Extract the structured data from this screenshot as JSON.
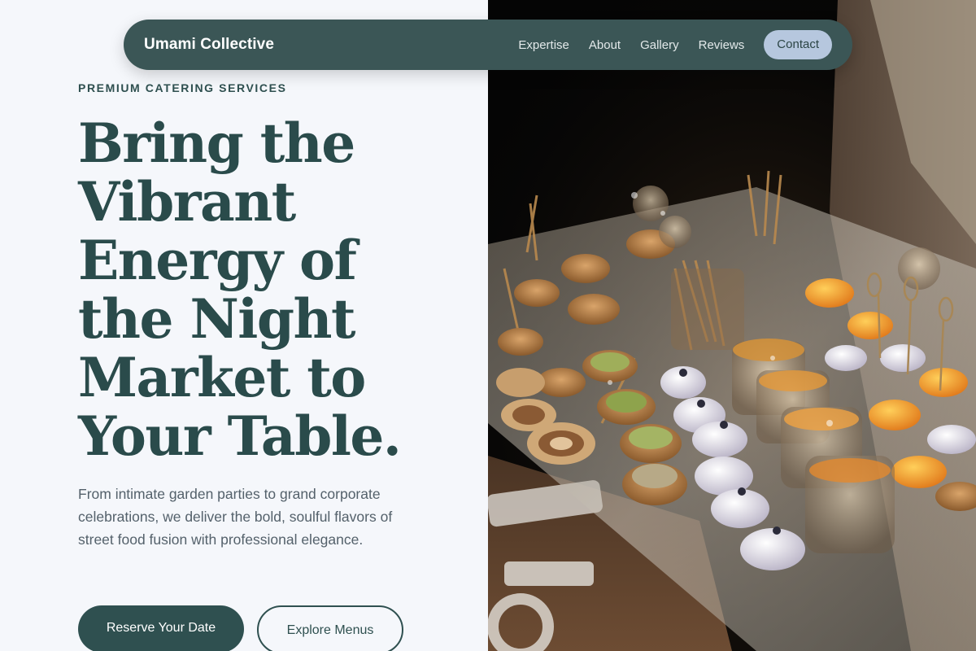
{
  "nav": {
    "brand": "Umami Collective",
    "links": [
      "Expertise",
      "About",
      "Gallery",
      "Reviews"
    ],
    "cta": "Contact"
  },
  "hero": {
    "eyebrow": "PREMIUM CATERING SERVICES",
    "headline_lines": [
      "Bring the",
      "Vibrant",
      "Energy of",
      "the Night",
      "Market to",
      "Your Table."
    ],
    "description": "From intimate garden parties to grand corporate celebrations, we deliver the bold, soulful flavors of street food fusion with professional elegance.",
    "primary_cta": "Reserve Your Date",
    "secondary_cta": "Explore Menus"
  },
  "image": {
    "subject": "catering canapés on a glass serving tray"
  },
  "colors": {
    "navbar": "#3b5656",
    "primary": "#2f5050",
    "contact_button": "#b6c7de",
    "page_background": "#f5f7fb",
    "headline": "#2a4b4b"
  }
}
